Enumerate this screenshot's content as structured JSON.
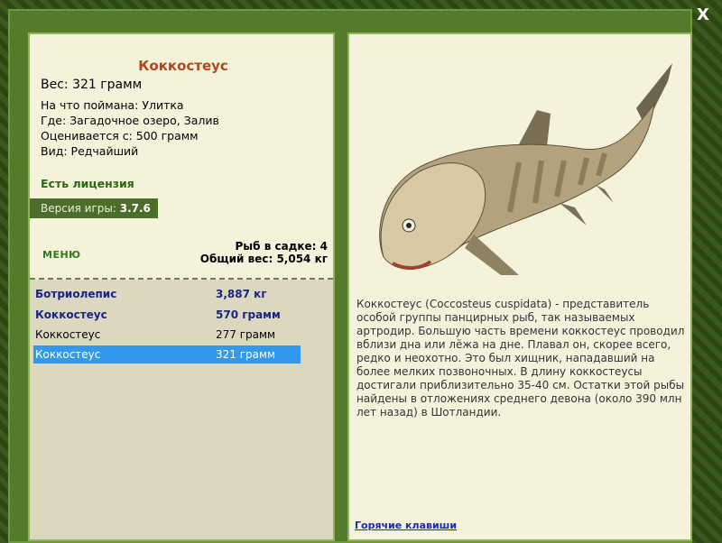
{
  "fish": {
    "name": "Коккостеус",
    "weight": "Вес: 321 грамм",
    "caught_on": "На что поймана: Улитка",
    "where": "Где: Загадочное озеро, Залив",
    "valued_from": "Оценивается с: 500 грамм",
    "kind": "Вид: Редчайший"
  },
  "license": "Есть лицензия",
  "version": {
    "label": "Версия игры:",
    "value": "3.7.6"
  },
  "menu_label": "МЕНЮ",
  "cage": {
    "count": "Рыб в садке: 4",
    "total": "Общий вес: 5,054 кг"
  },
  "catch_list": [
    {
      "name": "Ботриолепис",
      "weight": "3,887 кг"
    },
    {
      "name": "Коккостеус",
      "weight": "570 грамм"
    },
    {
      "name": "Коккостеус",
      "weight": "277 грамм"
    },
    {
      "name": "Коккостеус",
      "weight": "321 грамм"
    }
  ],
  "description": "Коккостеус (Coccosteus cuspidata) - представитель особой группы панцирных рыб, так называемых артродир. Большую часть времени коккостеус проводил вблизи дна или лёжа на дне. Плавал он, скорее всего, редко и неохотно. Это был хищник, нападавший на более мелких позвоночных. В длину коккостеусы достигали приблизительно 35-40 см. Остатки этой рыбы найдены в отложениях среднего девона (около 390 млн лет назад) в Шотландии.",
  "hotkeys_link": "Горячие клавиши",
  "close_glyph": "X",
  "colors": {
    "title": "#b5451b",
    "license": "#2a6a12",
    "selected": "#3399ee",
    "bold_row": "#1a2580"
  }
}
